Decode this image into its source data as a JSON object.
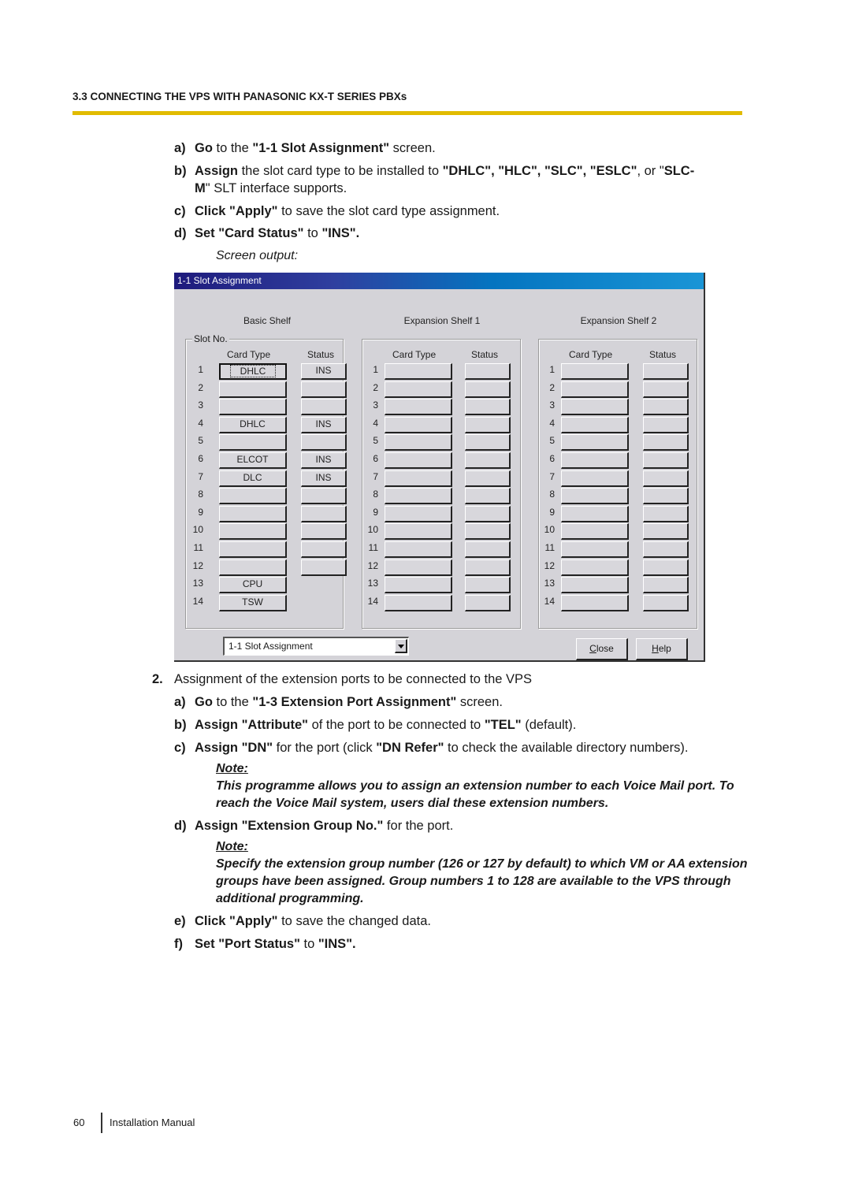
{
  "header": {
    "section_title": "3.3 CONNECTING THE VPS WITH PANASONIC KX-T SERIES PBXs",
    "rule_color": "#e1bb00"
  },
  "steps_part1": [
    {
      "label": "a)",
      "segments": [
        {
          "t": "Go",
          "b": true
        },
        {
          "t": " to the ",
          "b": false
        },
        {
          "t": "\"1-1 Slot Assignment\"",
          "b": true
        },
        {
          "t": " screen.",
          "b": false
        }
      ]
    },
    {
      "label": "b)",
      "segments": [
        {
          "t": "Assign",
          "b": true
        },
        {
          "t": " the slot card type to be installed to ",
          "b": false
        },
        {
          "t": "\"DHLC\", \"HLC\", \"SLC\", \"ESLC\"",
          "b": true
        },
        {
          "t": ", or \"",
          "b": false
        },
        {
          "t": "SLC-",
          "b": true
        }
      ],
      "continuation": [
        {
          "t": "M",
          "b": true
        },
        {
          "t": "\" SLT interface supports.",
          "b": false
        }
      ]
    },
    {
      "label": "c)",
      "segments": [
        {
          "t": "Click \"Apply\"",
          "b": true
        },
        {
          "t": " to save the slot card type assignment.",
          "b": false
        }
      ]
    },
    {
      "label": "d)",
      "segments": [
        {
          "t": "Set \"Card Status\"",
          "b": true
        },
        {
          "t": " to ",
          "b": false
        },
        {
          "t": "\"INS\".",
          "b": true
        }
      ]
    }
  ],
  "screen_output_label": "Screen output:",
  "window": {
    "title": "1-1 Slot Assignment",
    "slot_no_label": "Slot No.",
    "col_card_type": "Card Type",
    "col_status": "Status",
    "shelves": [
      {
        "name": "Basic Shelf",
        "slots": [
          {
            "no": "1",
            "card": "DHLC",
            "status": "INS",
            "focused": true
          },
          {
            "no": "2",
            "card": "",
            "status": ""
          },
          {
            "no": "3",
            "card": "",
            "status": ""
          },
          {
            "no": "4",
            "card": "DHLC",
            "status": "INS"
          },
          {
            "no": "5",
            "card": "",
            "status": ""
          },
          {
            "no": "6",
            "card": "ELCOT",
            "status": "INS"
          },
          {
            "no": "7",
            "card": "DLC",
            "status": "INS"
          },
          {
            "no": "8",
            "card": "",
            "status": ""
          },
          {
            "no": "9",
            "card": "",
            "status": ""
          },
          {
            "no": "10",
            "card": "",
            "status": ""
          },
          {
            "no": "11",
            "card": "",
            "status": ""
          },
          {
            "no": "12",
            "card": "",
            "status": ""
          },
          {
            "no": "13",
            "card": "CPU",
            "status": null
          },
          {
            "no": "14",
            "card": "TSW",
            "status": null
          }
        ]
      },
      {
        "name": "Expansion Shelf 1",
        "slots": [
          {
            "no": "1",
            "card": "",
            "status": ""
          },
          {
            "no": "2",
            "card": "",
            "status": ""
          },
          {
            "no": "3",
            "card": "",
            "status": ""
          },
          {
            "no": "4",
            "card": "",
            "status": ""
          },
          {
            "no": "5",
            "card": "",
            "status": ""
          },
          {
            "no": "6",
            "card": "",
            "status": ""
          },
          {
            "no": "7",
            "card": "",
            "status": ""
          },
          {
            "no": "8",
            "card": "",
            "status": ""
          },
          {
            "no": "9",
            "card": "",
            "status": ""
          },
          {
            "no": "10",
            "card": "",
            "status": ""
          },
          {
            "no": "11",
            "card": "",
            "status": ""
          },
          {
            "no": "12",
            "card": "",
            "status": ""
          },
          {
            "no": "13",
            "card": "",
            "status": ""
          },
          {
            "no": "14",
            "card": "",
            "status": ""
          }
        ]
      },
      {
        "name": "Expansion Shelf 2",
        "slots": [
          {
            "no": "1",
            "card": "",
            "status": ""
          },
          {
            "no": "2",
            "card": "",
            "status": ""
          },
          {
            "no": "3",
            "card": "",
            "status": ""
          },
          {
            "no": "4",
            "card": "",
            "status": ""
          },
          {
            "no": "5",
            "card": "",
            "status": ""
          },
          {
            "no": "6",
            "card": "",
            "status": ""
          },
          {
            "no": "7",
            "card": "",
            "status": ""
          },
          {
            "no": "8",
            "card": "",
            "status": ""
          },
          {
            "no": "9",
            "card": "",
            "status": ""
          },
          {
            "no": "10",
            "card": "",
            "status": ""
          },
          {
            "no": "11",
            "card": "",
            "status": ""
          },
          {
            "no": "12",
            "card": "",
            "status": ""
          },
          {
            "no": "13",
            "card": "",
            "status": ""
          },
          {
            "no": "14",
            "card": "",
            "status": ""
          }
        ]
      }
    ],
    "screen_select": {
      "value": "1-1 Slot Assignment"
    },
    "close_label": "Close",
    "help_label": "Help"
  },
  "part2": {
    "number": "2.",
    "heading": "Assignment of the extension ports to be connected to the VPS",
    "steps": [
      {
        "label": "a)",
        "segments": [
          {
            "t": "Go",
            "b": true
          },
          {
            "t": " to the ",
            "b": false
          },
          {
            "t": "\"1-3 Extension Port Assignment\"",
            "b": true
          },
          {
            "t": " screen.",
            "b": false
          }
        ]
      },
      {
        "label": "b)",
        "segments": [
          {
            "t": "Assign \"Attribute\"",
            "b": true
          },
          {
            "t": " of the port to be connected to ",
            "b": false
          },
          {
            "t": "\"TEL\"",
            "b": true
          },
          {
            "t": " (default).",
            "b": false
          }
        ]
      },
      {
        "label": "c)",
        "segments": [
          {
            "t": "Assign \"DN\"",
            "b": true
          },
          {
            "t": " for the port (click ",
            "b": false
          },
          {
            "t": "\"DN Refer\"",
            "b": true
          },
          {
            "t": " to check the available directory numbers).",
            "b": false
          }
        ]
      },
      {
        "label": "d)",
        "segments": [
          {
            "t": "Assign \"Extension Group No.\"",
            "b": true
          },
          {
            "t": " for the port.",
            "b": false
          }
        ]
      },
      {
        "label": "e)",
        "segments": [
          {
            "t": "Click \"Apply\"",
            "b": true
          },
          {
            "t": " to save the changed data.",
            "b": false
          }
        ]
      },
      {
        "label": "f)",
        "segments": [
          {
            "t": "Set \"Port Status\"",
            "b": true
          },
          {
            "t": " to ",
            "b": false
          },
          {
            "t": "\"INS\".",
            "b": true
          }
        ]
      }
    ],
    "note1": {
      "heading": "Note:",
      "text": "This programme allows you to assign an extension number to each Voice Mail port. To reach the Voice Mail system, users dial these extension numbers."
    },
    "note2": {
      "heading": "Note:",
      "text": "Specify the extension group number (126 or 127 by default) to which VM or AA extension groups have been assigned. Group numbers 1 to 128 are available to the VPS through additional programming."
    }
  },
  "footer": {
    "page_number": "60",
    "manual_title": "Installation Manual"
  }
}
